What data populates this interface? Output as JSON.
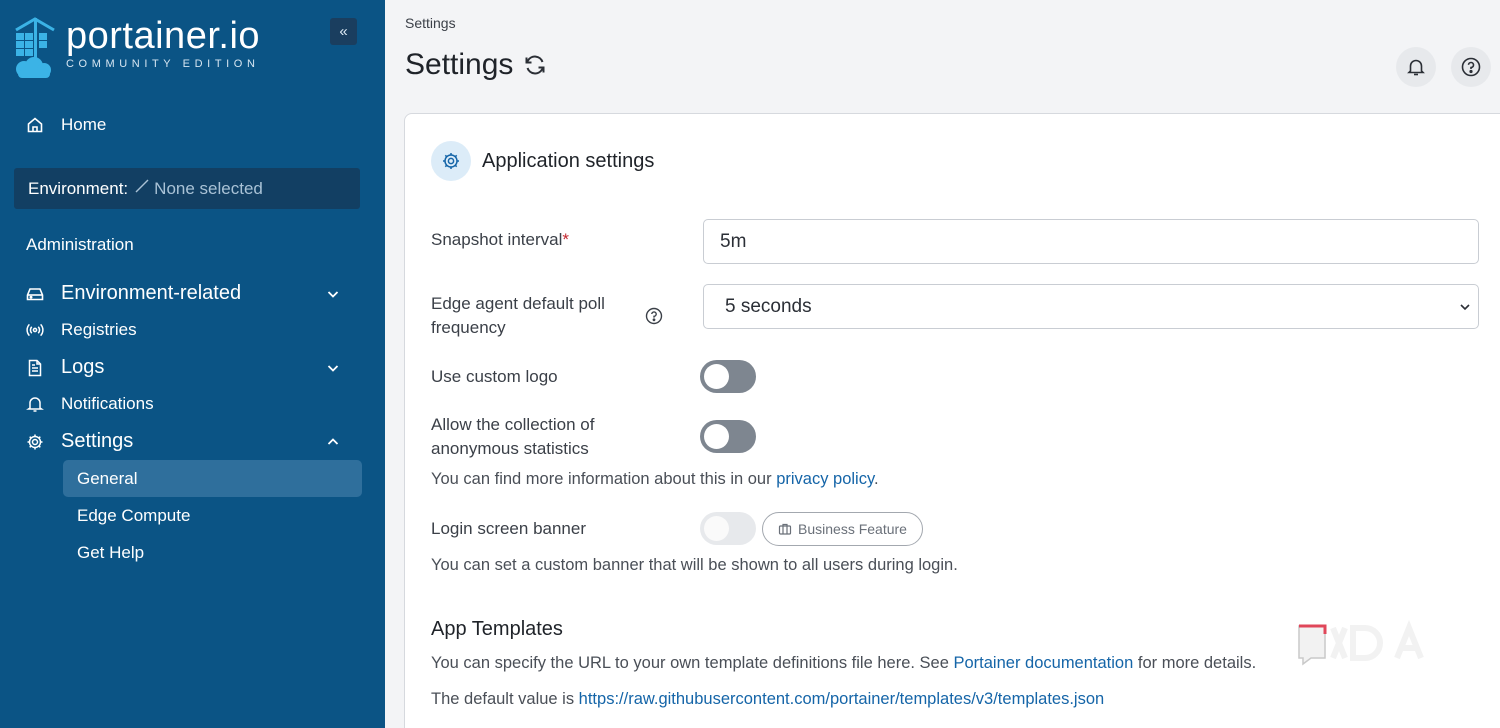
{
  "logo": {
    "name": "portainer.io",
    "edition": "COMMUNITY EDITION"
  },
  "sidebar": {
    "collapse_label": "«",
    "home": "Home",
    "environment_label": "Environment:",
    "environment_value": "None selected",
    "administration": "Administration",
    "items": [
      {
        "label": "Environment-related"
      },
      {
        "label": "Registries"
      },
      {
        "label": "Logs"
      },
      {
        "label": "Notifications"
      },
      {
        "label": "Settings"
      }
    ],
    "settings_sub": [
      {
        "label": "General",
        "active": true
      },
      {
        "label": "Edge Compute"
      },
      {
        "label": "Get Help"
      }
    ]
  },
  "header": {
    "breadcrumb": "Settings",
    "title": "Settings"
  },
  "app_settings": {
    "title": "Application settings",
    "snapshot_label": "Snapshot interval",
    "snapshot_required": "*",
    "snapshot_value": "5m",
    "edge_poll_label_line1": "Edge agent default poll",
    "edge_poll_label_line2": "frequency",
    "edge_poll_value": "5 seconds",
    "custom_logo_label": "Use custom logo",
    "anon_stats_label_line1": "Allow the collection of",
    "anon_stats_label_line2": "anonymous statistics",
    "privacy_text": "You can find more information about this in our ",
    "privacy_link": "privacy policy",
    "privacy_end": ".",
    "login_banner_label": "Login screen banner",
    "business_feature": "Business Feature",
    "banner_help": "You can set a custom banner that will be shown to all users during login.",
    "app_templates_title": "App Templates",
    "templates_text": "You can specify the URL to your own template definitions file here. See ",
    "templates_link": "Portainer documentation",
    "templates_end": " for more details.",
    "default_prefix": "The default value is ",
    "default_url": "https://raw.githubusercontent.com/portainer/templates/v3/templates.json"
  },
  "colors": {
    "sidebar_bg": "#0b5485",
    "active_item": "#2f6f9c",
    "link": "#1565a8",
    "required": "#c4262e"
  }
}
